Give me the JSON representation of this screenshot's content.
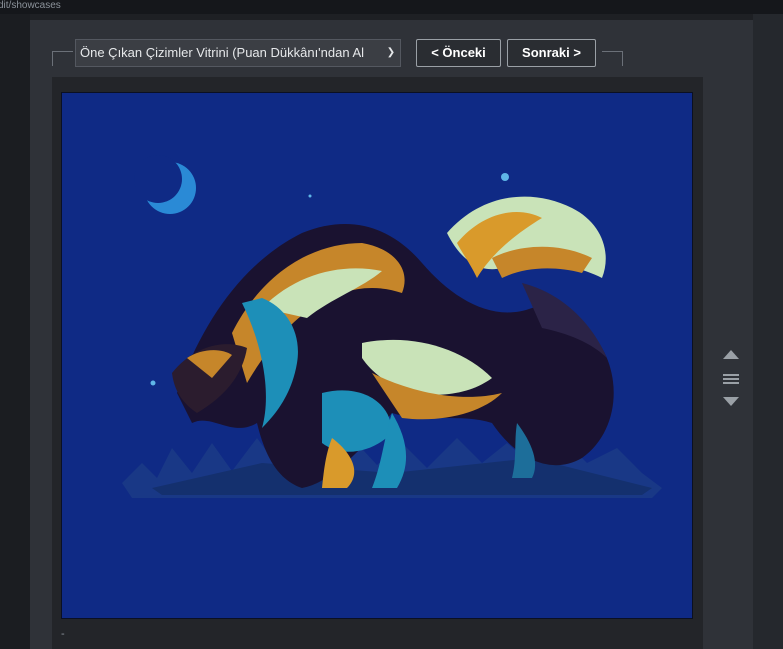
{
  "browser": {
    "url_fragment": "dit/showcases"
  },
  "showcase": {
    "selected": "Öne Çıkan Çizimler Vitrini (Puan Dükkânı'ndan Al",
    "prev_label": "< Önceki",
    "next_label": "Sonraki >",
    "caption": "-"
  },
  "colors": {
    "artwork_background": "#0f2a85",
    "panel": "#2f3238",
    "button_border": "#9aa0a6"
  },
  "icons": [
    "chevron-down-icon",
    "move-up-icon",
    "drag-handle-icon",
    "move-down-icon"
  ]
}
